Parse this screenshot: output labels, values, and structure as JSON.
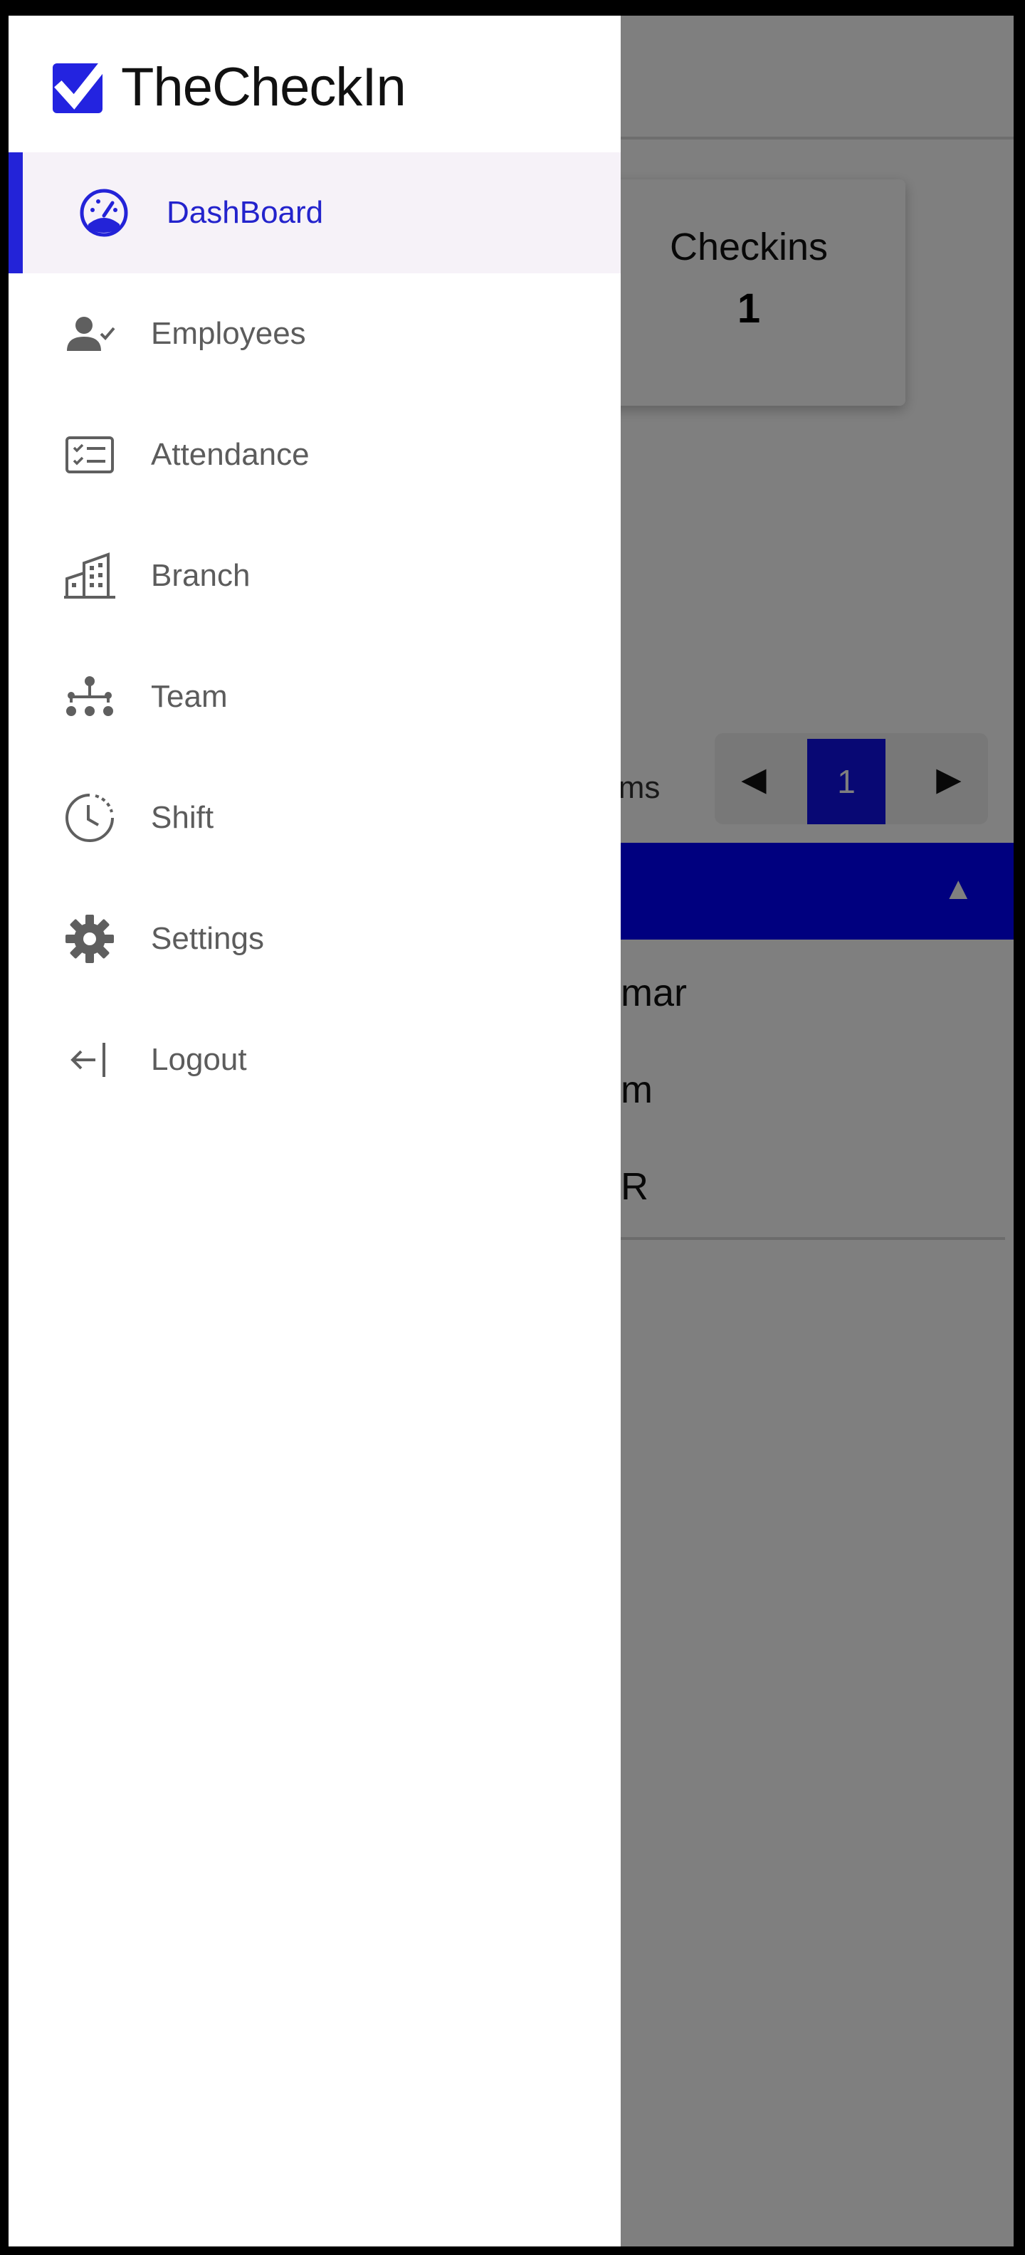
{
  "app": {
    "name": "TheCheckIn",
    "accent_color": "#2323D8",
    "header_color": "#0000FF"
  },
  "background_page": {
    "card": {
      "title": "Checkins",
      "value": "1"
    },
    "pagination": {
      "items_label_partial": "tems",
      "current_page": "1"
    },
    "table_rows_partial": [
      "mar",
      "m",
      "R"
    ]
  },
  "sidebar": {
    "items": [
      {
        "label": "DashBoard",
        "icon": "dashboard-gauge-icon",
        "active": true
      },
      {
        "label": "Employees",
        "icon": "employee-check-icon",
        "active": false
      },
      {
        "label": "Attendance",
        "icon": "checklist-icon",
        "active": false
      },
      {
        "label": "Branch",
        "icon": "building-icon",
        "active": false
      },
      {
        "label": "Team",
        "icon": "org-chart-icon",
        "active": false
      },
      {
        "label": "Shift",
        "icon": "clock-icon",
        "active": false
      },
      {
        "label": "Settings",
        "icon": "gear-icon",
        "active": false
      },
      {
        "label": "Logout",
        "icon": "logout-arrow-icon",
        "active": false
      }
    ]
  }
}
